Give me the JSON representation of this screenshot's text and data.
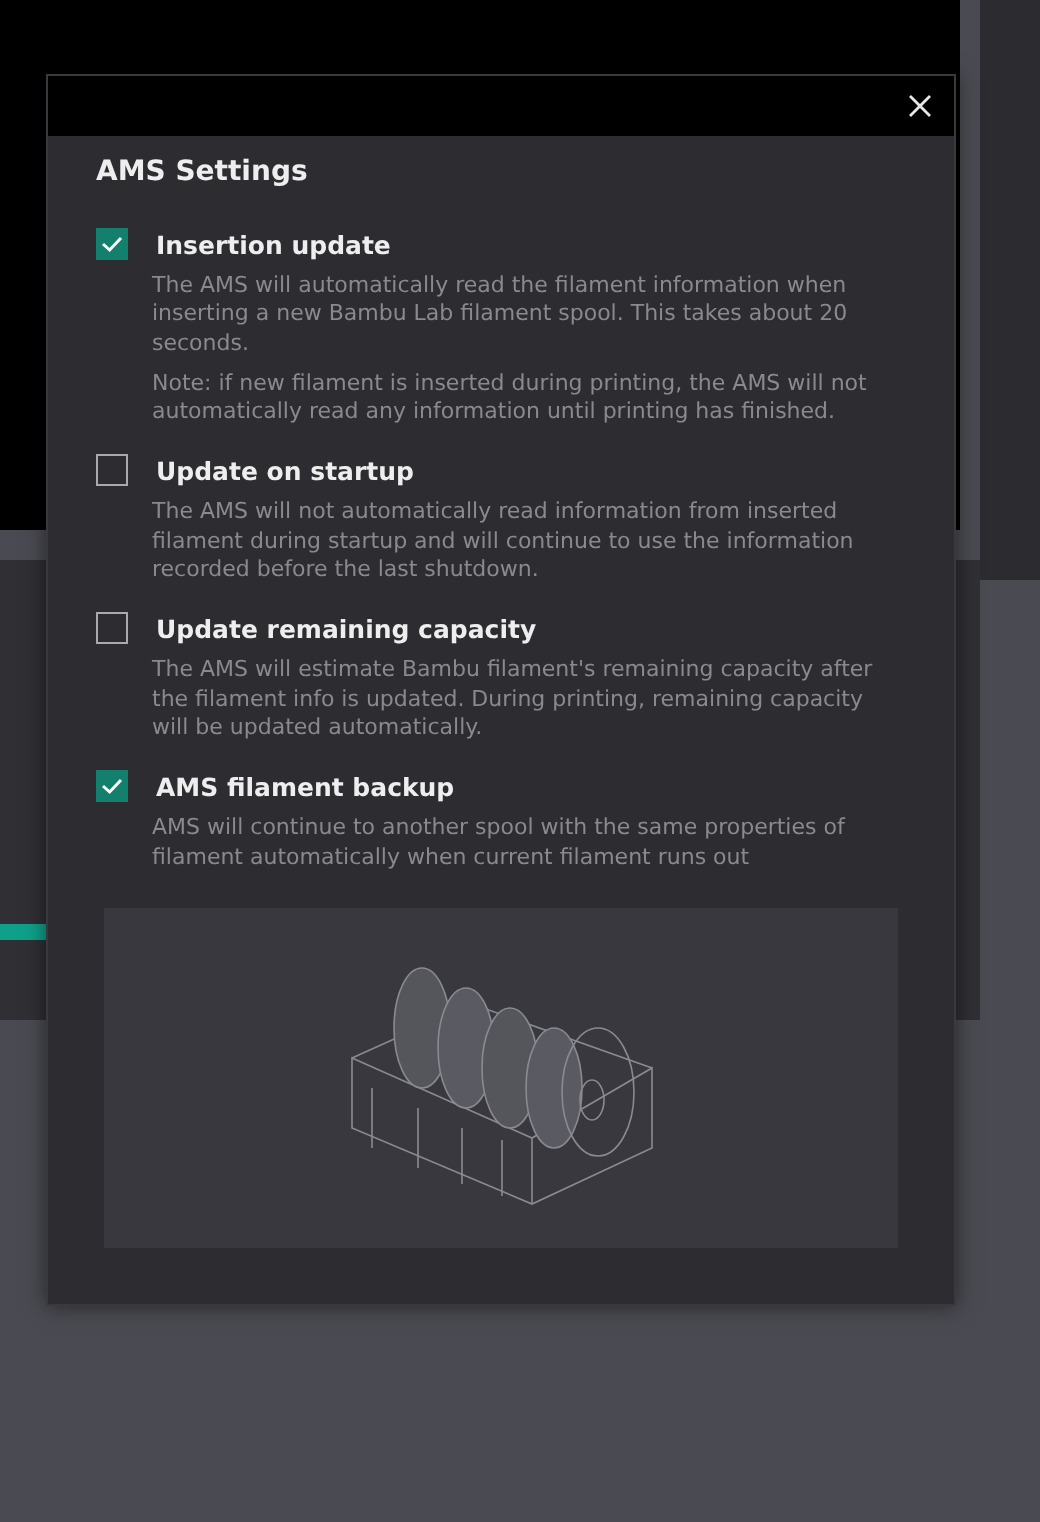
{
  "dialog": {
    "title": "AMS Settings",
    "options": [
      {
        "label": "Insertion update",
        "checked": true,
        "descriptions": [
          "The AMS will automatically read the filament information when inserting a new Bambu Lab filament spool. This takes about 20 seconds.",
          "Note: if new filament is inserted during  printing, the AMS will not automatically read any information until printing has finished."
        ]
      },
      {
        "label": "Update on startup",
        "checked": false,
        "descriptions": [
          "The AMS will not automatically read information from inserted filament during startup and will continue to use the information recorded before the last shutdown."
        ]
      },
      {
        "label": "Update remaining capacity",
        "checked": false,
        "descriptions": [
          "The AMS will estimate Bambu filament's remaining capacity after the filament info is updated. During printing, remaining capacity will be updated automatically."
        ]
      },
      {
        "label": "AMS filament backup",
        "checked": true,
        "descriptions": [
          "AMS will continue to another spool with the same properties of filament automatically when current filament runs out"
        ]
      }
    ]
  }
}
